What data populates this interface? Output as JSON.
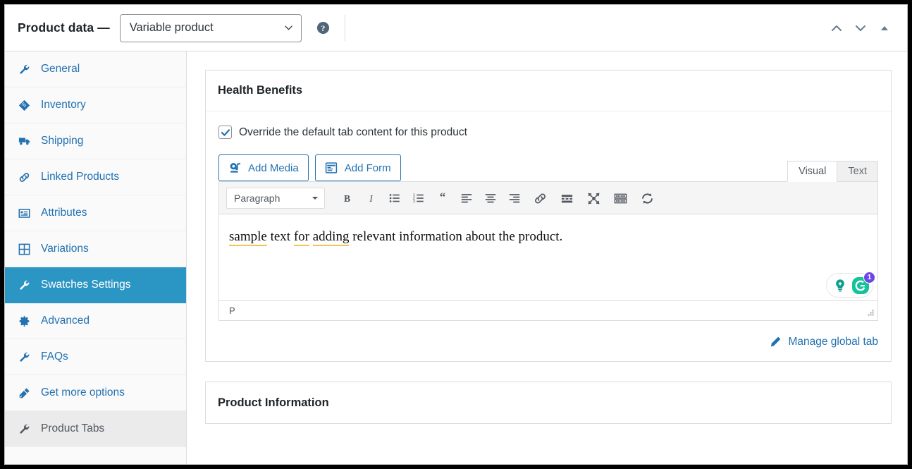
{
  "header": {
    "title": "Product data —",
    "product_type": {
      "value": "Variable product",
      "icon": "chevron-down-icon"
    },
    "help_icon": "help-circle-icon",
    "controls": [
      {
        "name": "move-up-button",
        "icon": "chevron-up-icon"
      },
      {
        "name": "move-down-button",
        "icon": "chevron-down-icon"
      },
      {
        "name": "toggle-panel-button",
        "icon": "triangle-up-icon"
      }
    ]
  },
  "sidebar": {
    "items": [
      {
        "label": "General",
        "icon": "wrench-icon",
        "state": "default"
      },
      {
        "label": "Inventory",
        "icon": "archive-icon",
        "state": "default"
      },
      {
        "label": "Shipping",
        "icon": "truck-icon",
        "state": "default"
      },
      {
        "label": "Linked Products",
        "icon": "link-icon",
        "state": "default"
      },
      {
        "label": "Attributes",
        "icon": "list-box-icon",
        "state": "default"
      },
      {
        "label": "Variations",
        "icon": "grid-icon",
        "state": "default"
      },
      {
        "label": "Swatches Settings",
        "icon": "wrench-icon",
        "state": "active"
      },
      {
        "label": "Advanced",
        "icon": "gear-icon",
        "state": "default"
      },
      {
        "label": "FAQs",
        "icon": "wrench-icon",
        "state": "default"
      },
      {
        "label": "Get more options",
        "icon": "plugin-icon",
        "state": "default"
      },
      {
        "label": "Product Tabs",
        "icon": "wrench-icon",
        "state": "hovered"
      }
    ]
  },
  "main": {
    "health_benefits": {
      "title": "Health Benefits",
      "override_checkbox": {
        "label": "Override the default tab content for this product",
        "checked": true
      },
      "buttons": [
        {
          "label": "Add Media",
          "icon": "media-icon"
        },
        {
          "label": "Add Form",
          "icon": "form-icon"
        }
      ],
      "editor_tabs": [
        {
          "label": "Visual",
          "active": true
        },
        {
          "label": "Text",
          "active": false
        }
      ],
      "toolbar": {
        "format_select": "Paragraph",
        "tools": [
          {
            "name": "bold-button",
            "glyph": "B"
          },
          {
            "name": "italic-button",
            "glyph": "I"
          },
          {
            "name": "bulleted-list-button",
            "glyph": "ul"
          },
          {
            "name": "numbered-list-button",
            "glyph": "ol"
          },
          {
            "name": "blockquote-button",
            "glyph": "quote"
          },
          {
            "name": "align-left-button",
            "glyph": "alignleft"
          },
          {
            "name": "align-center-button",
            "glyph": "aligncenter"
          },
          {
            "name": "align-right-button",
            "glyph": "alignright"
          },
          {
            "name": "insert-link-button",
            "glyph": "link"
          },
          {
            "name": "read-more-button",
            "glyph": "more"
          },
          {
            "name": "fullscreen-button",
            "glyph": "fullscreen"
          },
          {
            "name": "keyboard-shortcuts-button",
            "glyph": "keyboard"
          },
          {
            "name": "undo-redo-button",
            "glyph": "redo"
          }
        ]
      },
      "content": {
        "full_text": "sample text for adding relevant information about the product.",
        "segments": [
          {
            "text": "sample",
            "underlined": true
          },
          {
            "text": " text ",
            "underlined": false
          },
          {
            "text": "for",
            "underlined": true
          },
          {
            "text": " ",
            "underlined": false
          },
          {
            "text": "adding",
            "underlined": true
          },
          {
            "text": " relevant information about the product.",
            "underlined": false
          }
        ]
      },
      "assistant": {
        "bulb_icon": "lightbulb-icon",
        "grammarly_icon": "grammarly-icon",
        "badge_count": "1"
      },
      "status_path": "P",
      "resize_handle": "resize-grip-icon",
      "manage_link": {
        "label": "Manage global tab",
        "icon": "pencil-icon"
      }
    },
    "product_information": {
      "title": "Product Information"
    }
  },
  "colors": {
    "accent_blue": "#2271b1",
    "active_teal": "#2b95c4",
    "squiggle_yellow": "#f3c34e",
    "badge_purple": "#6b46e5",
    "grammarly_green": "#15c39a"
  }
}
